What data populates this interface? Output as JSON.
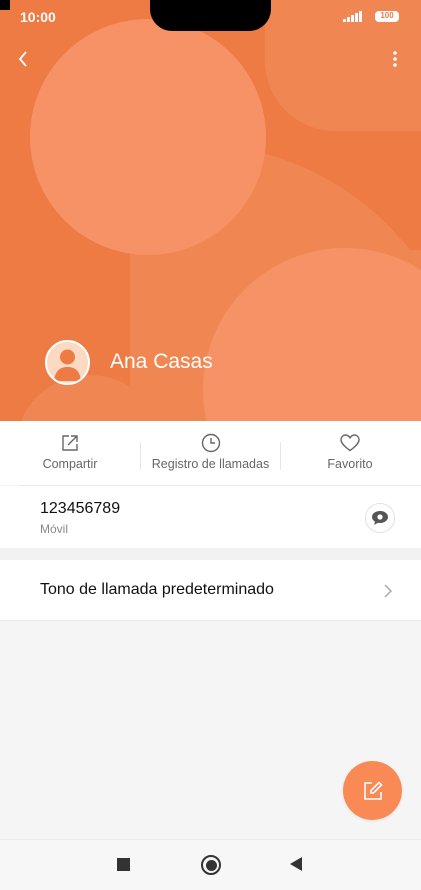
{
  "status_bar": {
    "time": "10:00",
    "battery": "100"
  },
  "hero": {
    "colors": {
      "background": "#ee7a44",
      "shape_light": "#f79266"
    }
  },
  "contact": {
    "name": "Ana Casas"
  },
  "actions": [
    {
      "label": "Compartir",
      "icon": "share-icon"
    },
    {
      "label": "Registro de llamadas",
      "icon": "clock-icon"
    },
    {
      "label": "Favorito",
      "icon": "heart-icon"
    }
  ],
  "phone": {
    "number": "123456789",
    "type": "Móvil"
  },
  "ringtone": {
    "label": "Tono de llamada predeterminado"
  },
  "fab": {
    "icon": "edit-icon"
  },
  "nav": {
    "icons": [
      "recents-square-icon",
      "home-circle-icon",
      "back-triangle-icon"
    ]
  }
}
